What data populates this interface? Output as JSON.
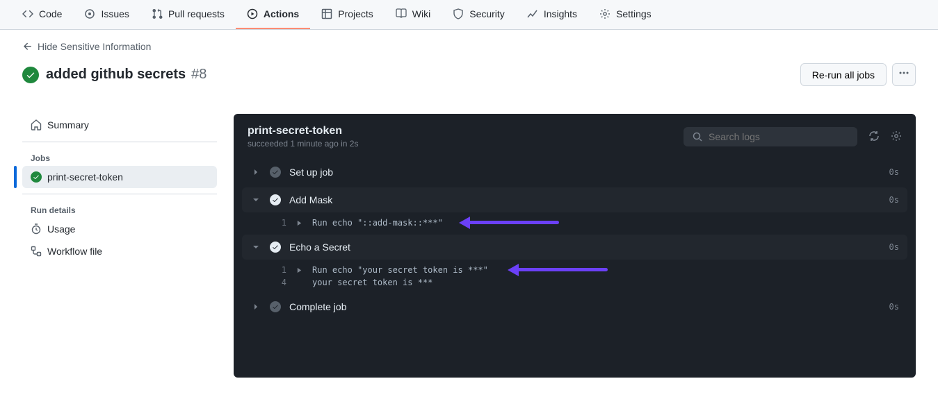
{
  "nav": {
    "code": "Code",
    "issues": "Issues",
    "pulls": "Pull requests",
    "actions": "Actions",
    "projects": "Projects",
    "wiki": "Wiki",
    "security": "Security",
    "insights": "Insights",
    "settings": "Settings"
  },
  "back_link": "Hide Sensitive Information",
  "run": {
    "title": "added github secrets",
    "number": "#8",
    "rerun_label": "Re-run all jobs"
  },
  "sidebar": {
    "summary": "Summary",
    "jobs_heading": "Jobs",
    "job_name": "print-secret-token",
    "run_details_heading": "Run details",
    "usage": "Usage",
    "workflow_file": "Workflow file"
  },
  "log": {
    "title": "print-secret-token",
    "subtitle": "succeeded 1 minute ago in 2s",
    "search_placeholder": "Search logs",
    "steps": [
      {
        "name": "Set up job",
        "expanded": false,
        "time": "0s",
        "lines": []
      },
      {
        "name": "Add Mask",
        "expanded": true,
        "time": "0s",
        "lines": [
          {
            "num": "1",
            "caret": true,
            "text": "Run echo \"::add-mask::***\""
          }
        ]
      },
      {
        "name": "Echo a Secret",
        "expanded": true,
        "time": "0s",
        "lines": [
          {
            "num": "1",
            "caret": true,
            "text": "Run echo \"your secret token is ***\""
          },
          {
            "num": "4",
            "caret": false,
            "text": "your secret token is ***"
          }
        ]
      },
      {
        "name": "Complete job",
        "expanded": false,
        "time": "0s",
        "lines": []
      }
    ]
  }
}
